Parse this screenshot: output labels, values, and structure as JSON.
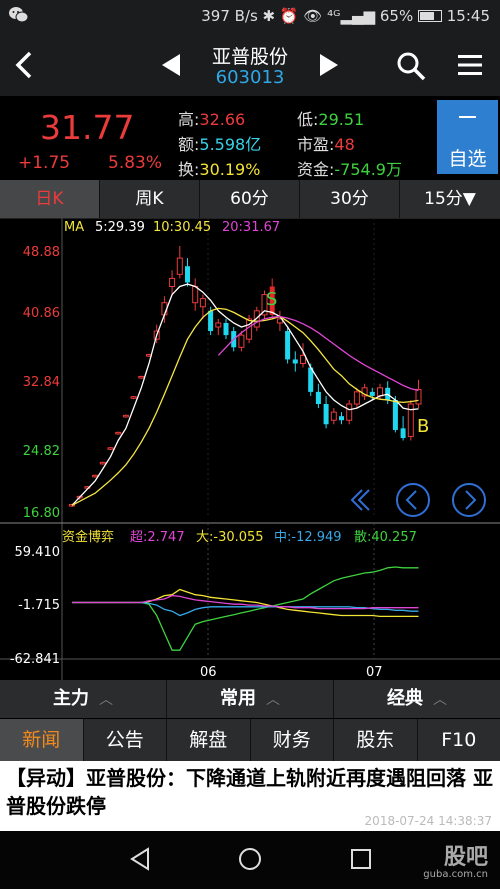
{
  "status_bar": {
    "left_icon": "wechat-icon",
    "right_text": "397 B/s ✱ ⏰ 👁 ⁴ᴳ▂▄▆ 65%",
    "time": "15:45"
  },
  "nav": {
    "title": "亚普股份",
    "code": "603013"
  },
  "quote": {
    "price": "31.77",
    "change": "+1.75",
    "change_pct": "5.83%",
    "high_label": "高:",
    "high_value": "32.66",
    "amount_label": "额:",
    "amount_value": "5.598亿",
    "turnover_label": "换:",
    "turnover_value": "30.19%",
    "low_label": "低:",
    "low_value": "29.51",
    "pe_label": "市盈:",
    "pe_value": "48",
    "fund_label": "资金:",
    "fund_value": "-754.9万",
    "zixuan_label": "自选"
  },
  "period_tabs": [
    "日K",
    "周K",
    "60分",
    "30分",
    "15分▼"
  ],
  "chart": {
    "ma_label": "MA",
    "ma5": "5:29.39",
    "ma10": "10:30.45",
    "ma20": "20:31.67",
    "price_ticks": [
      "48.88",
      "40.86",
      "32.84",
      "24.82",
      "16.80"
    ],
    "marker_s": "S",
    "marker_b": "B",
    "sub_title": "资金博弈",
    "sub_super": "超:2.747",
    "sub_big": "大:-30.055",
    "sub_mid": "中:-12.949",
    "sub_small": "散:40.257",
    "sub_ticks": [
      "59.410",
      "-1.715",
      "-62.841"
    ],
    "x_ticks": [
      "06",
      "07"
    ]
  },
  "func_tabs": [
    "主力",
    "常用",
    "经典"
  ],
  "info_tabs": [
    "新闻",
    "公告",
    "解盘",
    "财务",
    "股东",
    "F10"
  ],
  "headline": {
    "text": "【异动】亚普股份：下降通道上轨附近再度遇阻回落 亚普股份跌停",
    "timestamp": "2018-07-24 14:38:37"
  },
  "watermark": {
    "brand": "股吧",
    "url": "guba.com.cn"
  },
  "colors": {
    "up": "#ec3b3b",
    "down": "#20d7f0",
    "ma5": "#ffffff",
    "ma10": "#f5e642",
    "ma20": "#e046d6",
    "accent": "#2f7fd1"
  },
  "chart_data": {
    "type": "candlestick",
    "ylim": [
      16.8,
      48.88
    ],
    "candles": [
      {
        "o": 17.5,
        "h": 17.7,
        "l": 17.3,
        "c": 17.6,
        "d": "up"
      },
      {
        "o": 18.5,
        "h": 18.7,
        "l": 18.2,
        "c": 18.6,
        "d": "up"
      },
      {
        "o": 19.7,
        "h": 19.9,
        "l": 19.5,
        "c": 19.8,
        "d": "up"
      },
      {
        "o": 21.1,
        "h": 21.3,
        "l": 20.9,
        "c": 21.2,
        "d": "up"
      },
      {
        "o": 22.7,
        "h": 22.9,
        "l": 22.5,
        "c": 22.8,
        "d": "up"
      },
      {
        "o": 24.5,
        "h": 24.7,
        "l": 24.3,
        "c": 24.6,
        "d": "up"
      },
      {
        "o": 26.4,
        "h": 26.6,
        "l": 26.2,
        "c": 26.5,
        "d": "up"
      },
      {
        "o": 28.5,
        "h": 28.7,
        "l": 28.3,
        "c": 28.6,
        "d": "up"
      },
      {
        "o": 30.8,
        "h": 31.0,
        "l": 30.6,
        "c": 30.9,
        "d": "up"
      },
      {
        "o": 33.3,
        "h": 33.5,
        "l": 33.1,
        "c": 33.4,
        "d": "up"
      },
      {
        "o": 36.0,
        "h": 36.2,
        "l": 35.8,
        "c": 36.1,
        "d": "up"
      },
      {
        "o": 38.0,
        "h": 39.8,
        "l": 37.5,
        "c": 39.0,
        "d": "up"
      },
      {
        "o": 41.0,
        "h": 43.3,
        "l": 40.0,
        "c": 42.5,
        "d": "up"
      },
      {
        "o": 44.5,
        "h": 46.5,
        "l": 43.5,
        "c": 45.5,
        "d": "up"
      },
      {
        "o": 46.0,
        "h": 49.5,
        "l": 45.5,
        "c": 48.0,
        "d": "up"
      },
      {
        "o": 47.0,
        "h": 48.0,
        "l": 44.5,
        "c": 45.0,
        "d": "down"
      },
      {
        "o": 44.5,
        "h": 45.5,
        "l": 41.5,
        "c": 42.5,
        "d": "up"
      },
      {
        "o": 42.0,
        "h": 43.5,
        "l": 40.5,
        "c": 43.0,
        "d": "up"
      },
      {
        "o": 41.5,
        "h": 42.0,
        "l": 38.5,
        "c": 39.0,
        "d": "down"
      },
      {
        "o": 39.5,
        "h": 40.5,
        "l": 38.5,
        "c": 40.0,
        "d": "up"
      },
      {
        "o": 40.0,
        "h": 40.5,
        "l": 38.0,
        "c": 38.5,
        "d": "down"
      },
      {
        "o": 39.0,
        "h": 39.5,
        "l": 36.5,
        "c": 37.0,
        "d": "down"
      },
      {
        "o": 37.0,
        "h": 39.0,
        "l": 36.5,
        "c": 38.5,
        "d": "up"
      },
      {
        "o": 38.0,
        "h": 41.0,
        "l": 37.5,
        "c": 40.5,
        "d": "up"
      },
      {
        "o": 39.5,
        "h": 42.0,
        "l": 39.0,
        "c": 41.5,
        "d": "up"
      },
      {
        "o": 41.0,
        "h": 44.0,
        "l": 40.5,
        "c": 43.5,
        "d": "up"
      },
      {
        "o": 44.5,
        "h": 45.5,
        "l": 40.5,
        "c": 41.0,
        "d": "red"
      },
      {
        "o": 40.0,
        "h": 41.5,
        "l": 39.0,
        "c": 40.5,
        "d": "up"
      },
      {
        "o": 39.0,
        "h": 39.5,
        "l": 35.0,
        "c": 35.5,
        "d": "down"
      },
      {
        "o": 35.5,
        "h": 36.5,
        "l": 34.0,
        "c": 35.0,
        "d": "down"
      },
      {
        "o": 35.0,
        "h": 37.5,
        "l": 34.5,
        "c": 36.0,
        "d": "up"
      },
      {
        "o": 34.5,
        "h": 35.0,
        "l": 31.0,
        "c": 31.5,
        "d": "down"
      },
      {
        "o": 31.5,
        "h": 32.5,
        "l": 29.5,
        "c": 30.0,
        "d": "down"
      },
      {
        "o": 30.0,
        "h": 31.0,
        "l": 27.0,
        "c": 27.5,
        "d": "down"
      },
      {
        "o": 28.0,
        "h": 29.5,
        "l": 27.5,
        "c": 29.0,
        "d": "up"
      },
      {
        "o": 28.5,
        "h": 29.0,
        "l": 27.5,
        "c": 28.0,
        "d": "down"
      },
      {
        "o": 28.0,
        "h": 30.5,
        "l": 27.5,
        "c": 30.0,
        "d": "up"
      },
      {
        "o": 30.0,
        "h": 32.0,
        "l": 29.5,
        "c": 31.5,
        "d": "up"
      },
      {
        "o": 31.0,
        "h": 32.5,
        "l": 30.5,
        "c": 32.0,
        "d": "up"
      },
      {
        "o": 31.5,
        "h": 32.0,
        "l": 30.5,
        "c": 31.0,
        "d": "down"
      },
      {
        "o": 31.0,
        "h": 32.5,
        "l": 30.5,
        "c": 32.0,
        "d": "up"
      },
      {
        "o": 32.0,
        "h": 32.8,
        "l": 30.0,
        "c": 30.5,
        "d": "down"
      },
      {
        "o": 30.5,
        "h": 31.0,
        "l": 26.5,
        "c": 26.8,
        "d": "down"
      },
      {
        "o": 27.0,
        "h": 28.5,
        "l": 25.5,
        "c": 25.8,
        "d": "down"
      },
      {
        "o": 26.0,
        "h": 30.5,
        "l": 25.5,
        "c": 30.0,
        "d": "up"
      },
      {
        "o": 30.0,
        "h": 33.0,
        "l": 29.5,
        "c": 31.8,
        "d": "up"
      }
    ],
    "ma5": [
      17.5,
      18.5,
      19.5,
      20.5,
      22.0,
      23.5,
      25.5,
      27.0,
      29.5,
      32.0,
      35.0,
      38.5,
      41.0,
      43.5,
      44.5,
      44.8,
      44.5,
      43.8,
      42.8,
      41.5,
      40.7,
      40.0,
      39.5,
      39.8,
      40.6,
      41.5,
      41.3,
      40.8,
      39.5,
      38.0,
      36.5,
      34.5,
      33.0,
      31.5,
      30.5,
      29.8,
      29.3,
      29.5,
      30.0,
      30.5,
      31.0,
      31.2,
      30.5,
      29.5,
      29.3,
      29.4
    ],
    "ma10": [
      17.5,
      18.0,
      18.5,
      19.0,
      19.8,
      20.6,
      21.5,
      22.5,
      23.8,
      25.3,
      27.0,
      29.0,
      31.2,
      33.5,
      35.8,
      38.0,
      39.5,
      40.7,
      41.5,
      41.8,
      41.7,
      41.3,
      40.8,
      40.3,
      40.2,
      40.3,
      40.5,
      40.8,
      40.2,
      39.5,
      38.8,
      37.8,
      36.7,
      35.5,
      34.3,
      33.5,
      32.5,
      31.8,
      31.2,
      30.8,
      30.6,
      30.5,
      30.3,
      30.2,
      30.3,
      30.45
    ],
    "ma20": [
      null,
      null,
      null,
      null,
      null,
      null,
      null,
      null,
      null,
      null,
      null,
      null,
      null,
      null,
      null,
      null,
      null,
      null,
      null,
      36.0,
      37.0,
      38.0,
      38.8,
      39.5,
      40.1,
      40.5,
      40.7,
      40.8,
      40.6,
      40.3,
      39.9,
      39.4,
      38.8,
      38.1,
      37.4,
      36.7,
      36.0,
      35.4,
      34.8,
      34.3,
      33.8,
      33.3,
      32.8,
      32.3,
      31.9,
      31.67
    ],
    "sub_ylim": [
      -62.841,
      59.41
    ],
    "sub_series": {
      "super": [
        0,
        0,
        0,
        0,
        0,
        0,
        0,
        0,
        0,
        0,
        2,
        3,
        4,
        8,
        7,
        5,
        3,
        2,
        1,
        0,
        -1,
        -2,
        -2,
        -3,
        -3,
        -4,
        -4,
        -5,
        -5,
        -6,
        -6,
        -6,
        -7,
        -7,
        -7,
        -7,
        -7,
        -7,
        -7,
        -6,
        -6,
        -6,
        -6,
        -6,
        -6,
        -6
      ],
      "big": [
        0,
        0,
        0,
        0,
        0,
        0,
        0,
        0,
        0,
        0,
        1,
        4,
        8,
        9,
        15,
        12,
        9,
        8,
        6,
        5,
        4,
        3,
        2,
        1,
        0,
        -2,
        -4,
        -6,
        -8,
        -9,
        -10,
        -11,
        -12,
        -13,
        -14,
        -15,
        -15,
        -15,
        -15,
        -15,
        -16,
        -16,
        -16,
        -16,
        -16,
        -16
      ],
      "mid": [
        0,
        0,
        0,
        0,
        0,
        0,
        0,
        0,
        0,
        0,
        -1,
        -3,
        -8,
        -10,
        -15,
        -12,
        -8,
        -6,
        -5,
        -5,
        -5,
        -5,
        -5,
        -5,
        -5,
        -5,
        -5,
        -5,
        -5,
        -5,
        -5,
        -5,
        -5,
        -5,
        -5,
        -5,
        -5,
        -6,
        -6,
        -7,
        -8,
        -8,
        -9,
        -9,
        -10,
        -10
      ],
      "small": [
        0,
        0,
        0,
        0,
        0,
        0,
        0,
        0,
        0,
        0,
        -2,
        -15,
        -35,
        -55,
        -55,
        -40,
        -25,
        -22,
        -20,
        -18,
        -16,
        -14,
        -12,
        -10,
        -8,
        -6,
        -4,
        -2,
        0,
        2,
        4,
        10,
        15,
        20,
        25,
        28,
        30,
        32,
        34,
        35,
        37,
        40,
        41,
        40,
        40,
        40
      ]
    }
  }
}
